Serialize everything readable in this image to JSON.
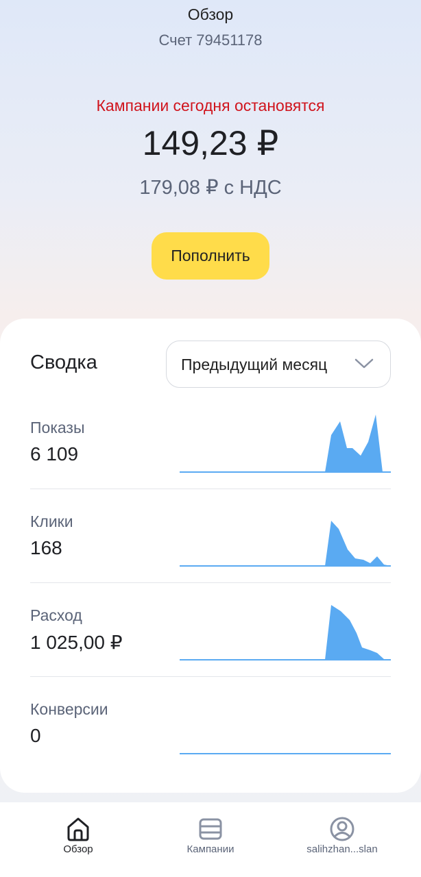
{
  "header": {
    "title": "Обзор",
    "account": "Счет 79451178"
  },
  "balance": {
    "warning": "Кампании сегодня остановятся",
    "amount": "149,23 ₽",
    "amount_with_vat": "179,08 ₽ с НДС",
    "topup_label": "Пополнить"
  },
  "summary": {
    "title": "Сводка",
    "period": "Предыдущий месяц",
    "metrics": [
      {
        "label": "Показы",
        "value": "6 109"
      },
      {
        "label": "Клики",
        "value": "168"
      },
      {
        "label": "Расход",
        "value": "1 025,00 ₽"
      },
      {
        "label": "Конверсии",
        "value": "0"
      }
    ]
  },
  "navbar": {
    "items": [
      {
        "label": "Обзор",
        "icon": "home-icon",
        "active": true
      },
      {
        "label": "Кампании",
        "icon": "campaigns-icon",
        "active": false
      },
      {
        "label": "salihzhan...slan",
        "icon": "profile-icon",
        "active": false
      }
    ]
  },
  "colors": {
    "accent_yellow": "#ffdc4a",
    "warning_red": "#d0141d",
    "chart_blue": "#5aaaf2",
    "muted_text": "#5b6478",
    "nav_inactive": "#8a92a3"
  }
}
